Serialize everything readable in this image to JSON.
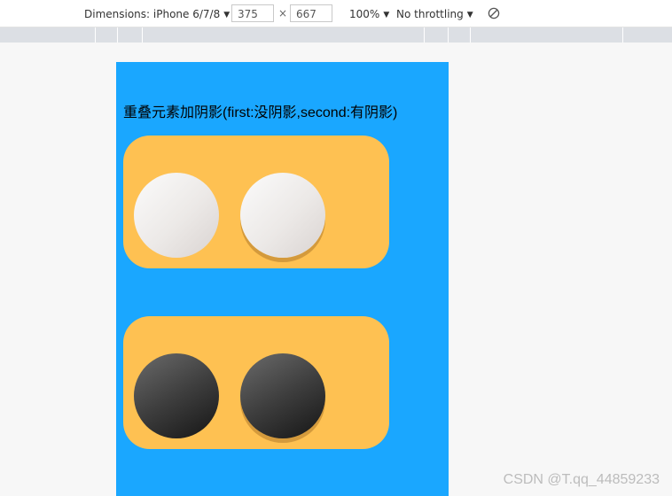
{
  "devtools": {
    "device_label": "Dimensions: iPhone 6/7/8",
    "width_value": "375",
    "height_value": "667",
    "times_sign": "×",
    "zoom_label": "100%",
    "throttle_label": "No throttling",
    "caret_glyph": "▼",
    "rotate_icon": "rotate-icon"
  },
  "page": {
    "heading": "重叠元素加阴影(first:没阴影,second:有阴影)",
    "background_color": "#1aa7ff",
    "card_color": "#fec152",
    "cards": [
      {
        "piece_color": "white",
        "first_shadow": false,
        "second_shadow": true
      },
      {
        "piece_color": "black",
        "first_shadow": false,
        "second_shadow": true
      }
    ]
  },
  "watermark": "CSDN @T.qq_44859233"
}
